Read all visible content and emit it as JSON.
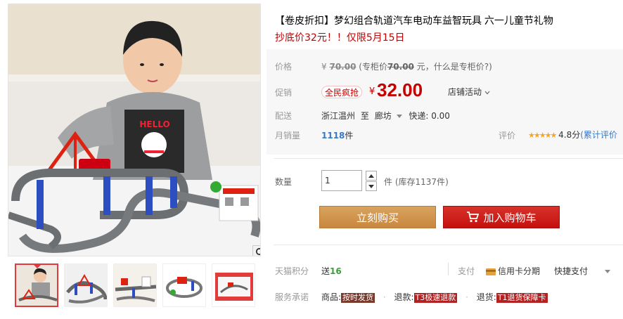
{
  "product": {
    "title": "【卷皮折扣】梦幻组合轨道汽车电动车益智玩具 六一儿童节礼物",
    "subtitle": "抄底价32元！！仅限5月15日"
  },
  "price": {
    "label": "价格",
    "original": "70.00",
    "currency": "¥",
    "counter_prefix": "(专柜价",
    "counter_price": "70.00",
    "counter_suffix": "元，",
    "help_link": "什么是专柜价?",
    "close_paren": ")"
  },
  "promo": {
    "label": "促销",
    "badge": "全民疯抢",
    "currency": "¥",
    "price": "32.00",
    "shop_activity": "店铺活动"
  },
  "shipping": {
    "label": "配送",
    "from": "浙江温州",
    "to_word": "至",
    "to": "廊坊",
    "fee": "快递: 0.00"
  },
  "sales": {
    "label": "月销量",
    "count": "1118",
    "unit": "件",
    "rating_label": "评价",
    "stars": "★★★★★",
    "score": "4.8分",
    "reviews_link": "(累计评价"
  },
  "quantity": {
    "label": "数量",
    "value": "1",
    "stock_prefix": "件",
    "stock": "(库存1137件)"
  },
  "buttons": {
    "buy_now": "立刻购买",
    "add_to_cart": "加入购物车"
  },
  "points": {
    "label": "天猫积分",
    "give": "送",
    "value": "16",
    "pay_label": "支付",
    "credit_card": "信用卡分期",
    "quick_pay": "快捷支付"
  },
  "service": {
    "label": "服务承诺",
    "goods_prefix": "商品:",
    "goods_tag": "按时发货",
    "refund_prefix": "退款:",
    "refund_tag": "T3极速退款",
    "return_prefix": "退货:",
    "return_tag": "T1退货保障卡"
  },
  "colors": {
    "accent_red": "#c40000",
    "buy_orange": "#d9a35e",
    "cart_red": "#c4100e",
    "link_blue": "#3879c7",
    "star_gold": "#f5a623"
  },
  "icons": [
    "zoom-icon",
    "cart-icon",
    "chevron-down-icon",
    "credit-card-icon",
    "caret-down-icon",
    "caret-up-icon"
  ]
}
